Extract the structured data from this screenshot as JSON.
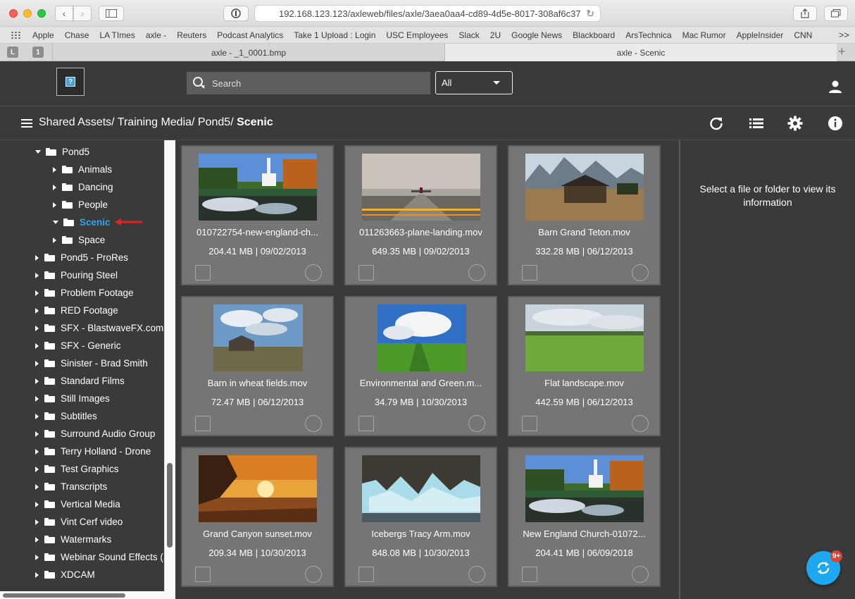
{
  "browser": {
    "url": "192.168.123.123/axleweb/files/axle/3aea0aa4-cd89-4d5e-8017-308af6c37",
    "bookmarks": [
      "Apple",
      "Chase",
      "LA TImes",
      "axle -",
      "Reuters",
      "Podcast Analytics",
      "Take 1 Upload : Login",
      "USC Employees",
      "Slack",
      "2U",
      "Google News",
      "Blackboard",
      "ArsTechnica",
      "Mac Rumor",
      "AppleInsider",
      "CNN"
    ],
    "more_label": ">>",
    "pinned_tabs": [
      "L",
      "1"
    ],
    "tabs": [
      {
        "title": "axle - _1_0001.bmp"
      },
      {
        "title": "axle - Scenic"
      }
    ]
  },
  "header": {
    "logo_glyph": "?",
    "search_placeholder": "Search",
    "filter_selected": "All"
  },
  "breadcrumb": {
    "parts": [
      "Shared Assets/",
      "Training Media/",
      "Pond5/"
    ],
    "current": "Scenic"
  },
  "sidebar": {
    "tree": [
      {
        "label": "Pond5",
        "level": 0,
        "expanded": true
      },
      {
        "label": "Animals",
        "level": 1
      },
      {
        "label": "Dancing",
        "level": 1
      },
      {
        "label": "People",
        "level": 1
      },
      {
        "label": "Scenic",
        "level": 1,
        "expanded": true,
        "active": true
      },
      {
        "label": "Space",
        "level": 1
      },
      {
        "label": "Pond5 - ProRes",
        "level": 0
      },
      {
        "label": "Pouring Steel",
        "level": 0
      },
      {
        "label": "Problem Footage",
        "level": 0
      },
      {
        "label": "RED Footage",
        "level": 0
      },
      {
        "label": "SFX - BlastwaveFX.com",
        "level": 0
      },
      {
        "label": "SFX - Generic",
        "level": 0
      },
      {
        "label": "Sinister - Brad Smith",
        "level": 0
      },
      {
        "label": "Standard Films",
        "level": 0
      },
      {
        "label": "Still Images",
        "level": 0
      },
      {
        "label": "Subtitles",
        "level": 0
      },
      {
        "label": "Surround Audio Group",
        "level": 0
      },
      {
        "label": "Terry Holland - Drone",
        "level": 0
      },
      {
        "label": "Test Graphics",
        "level": 0
      },
      {
        "label": "Transcripts",
        "level": 0
      },
      {
        "label": "Vertical Media",
        "level": 0
      },
      {
        "label": "Vint Cerf video",
        "level": 0
      },
      {
        "label": "Watermarks",
        "level": 0
      },
      {
        "label": "Webinar Sound Effects (S",
        "level": 0
      },
      {
        "label": "XDCAM",
        "level": 0
      }
    ]
  },
  "files": [
    {
      "name": "010722754-new-england-ch...",
      "meta": "204.41 MB | 09/02/2013",
      "thumb": "church"
    },
    {
      "name": "011263663-plane-landing.mov",
      "meta": "649.35 MB | 09/02/2013",
      "thumb": "plane"
    },
    {
      "name": "Barn Grand Teton.mov",
      "meta": "332.28 MB | 06/12/2013",
      "thumb": "barn-teton"
    },
    {
      "name": "Barn in wheat fields.mov",
      "meta": "72.47 MB | 06/12/2013",
      "thumb": "barn-wheat"
    },
    {
      "name": "Environmental and Green.m...",
      "meta": "34.79 MB | 10/30/2013",
      "thumb": "green-field"
    },
    {
      "name": "Flat landscape.mov",
      "meta": "442.59 MB | 06/12/2013",
      "thumb": "flat-landscape"
    },
    {
      "name": "Grand Canyon sunset.mov",
      "meta": "209.34 MB | 10/30/2013",
      "thumb": "canyon-sunset"
    },
    {
      "name": "Icebergs Tracy Arm.mov",
      "meta": "848.08 MB | 10/30/2013",
      "thumb": "icebergs"
    },
    {
      "name": "New England Church-01072...",
      "meta": "204.41 MB | 06/09/2018",
      "thumb": "church"
    }
  ],
  "info_panel": {
    "message": "Select a file or folder to view its information"
  },
  "fab": {
    "badge": "9+"
  },
  "colors": {
    "accent": "#2aa8f2",
    "app_bg": "#3a3a3a",
    "card_bg": "#757575",
    "badge": "#e0412f"
  }
}
